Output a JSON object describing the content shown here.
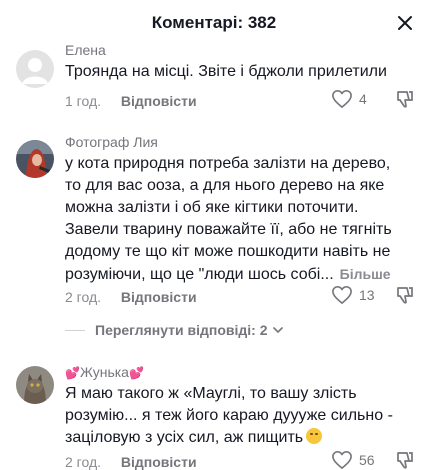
{
  "header": {
    "title": "Коментарі: 382"
  },
  "comments": [
    {
      "author": "Елена",
      "lines": [
        "Троянда на місці. Звіте і бджоли прилетили"
      ],
      "time": "1 год.",
      "reply": "Відповісти",
      "likes": "4"
    },
    {
      "author": "Фотограф Лия",
      "lines": [
        "у кота природня потреба залізти на дерево,",
        "то для вас ооза, а для нього дерево на яке",
        "можна залізти і об яке кігтики поточити.",
        "Завели тварину поважайте її, або не тягніть",
        "додому те що кіт може пошкодити навіть не",
        "розуміючи, що це \"люди шось собі..."
      ],
      "more": "Більше",
      "time": "2 год.",
      "reply": "Відповісти",
      "likes": "13"
    },
    {
      "author": "Жунька",
      "author_decor": "💕",
      "lines": [
        "Я маю такого ж «Мауглі, то вашу злість",
        "розумію... я теж його караю дуууже сильно -",
        "заціловую з усіх сил, аж пищить"
      ],
      "time": "2 год.",
      "reply": "Відповісти",
      "likes": "56"
    }
  ],
  "view_replies": "Переглянути відповіді: 2",
  "colors": {
    "text": "#161823",
    "muted": "#75767c",
    "bg": "#ffffff"
  },
  "icons": [
    "close-icon",
    "heart-icon",
    "dislike-icon",
    "chevron-down-icon",
    "grinning-emoji-icon"
  ]
}
